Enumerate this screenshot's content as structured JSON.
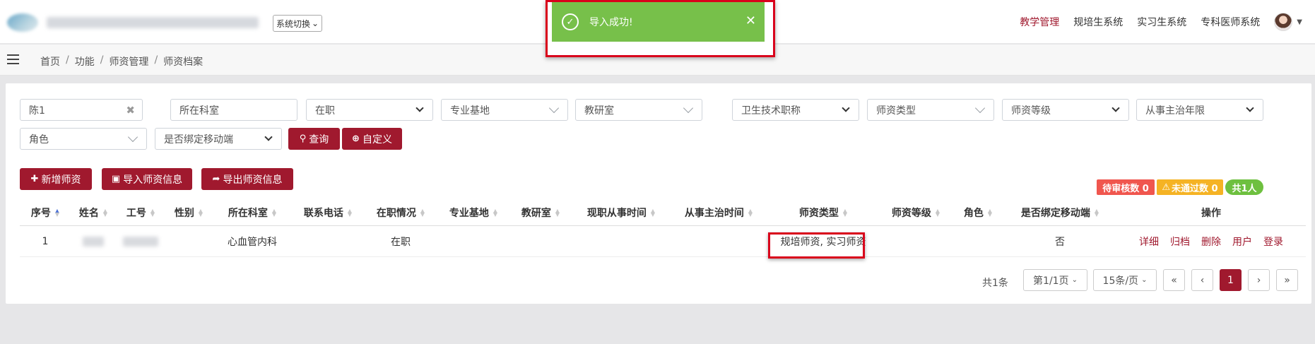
{
  "header": {
    "system_switch_label": "系统切换",
    "nav": [
      "教学管理",
      "规培生系统",
      "实习生系统",
      "专科医师系统"
    ]
  },
  "breadcrumb": [
    "首页",
    "功能",
    "师资管理",
    "师资档案"
  ],
  "toast": {
    "message": "导入成功!"
  },
  "filters": {
    "name": "陈1",
    "department_placeholder": "所在科室",
    "employment": "在职",
    "base_placeholder": "专业基地",
    "office_placeholder": "教研室",
    "title": "卫生技术职称",
    "teacher_type_placeholder": "师资类型",
    "teacher_level": "师资等级",
    "attending_years": "从事主治年限",
    "role_placeholder": "角色",
    "mobile_bound": "是否绑定移动端",
    "query_button": "查询",
    "custom_button": "自定义"
  },
  "actions": {
    "add": "新增师资",
    "import": "导入师资信息",
    "export": "导出师资信息"
  },
  "badges": {
    "pending": "待审核数 0",
    "rejected": "未通过数 0",
    "total": "共1人"
  },
  "table": {
    "headers": [
      "序号",
      "姓名",
      "工号",
      "性别",
      "所在科室",
      "联系电话",
      "在职情况",
      "专业基地",
      "教研室",
      "现职从事时间",
      "从事主治时间",
      "师资类型",
      "师资等级",
      "角色",
      "是否绑定移动端",
      "操作"
    ],
    "rows": [
      {
        "index": "1",
        "department": "心血管内科",
        "employment": "在职",
        "teacher_type": "规培师资, 实习师资",
        "mobile_bound": "否",
        "ops": [
          "详细",
          "归档",
          "删除",
          "用户",
          "登录"
        ]
      }
    ]
  },
  "pagination": {
    "total": "共1条",
    "page_select": "第1/1页",
    "size_select": "15条/页",
    "first": "«",
    "prev": "‹",
    "current": "1",
    "next": "›",
    "last": "»"
  },
  "colors": {
    "brand": "#a0192e",
    "toast": "#77c04a",
    "danger_badge": "#f0564e",
    "warn_badge": "#f5b324",
    "success_badge": "#6ec03f"
  }
}
